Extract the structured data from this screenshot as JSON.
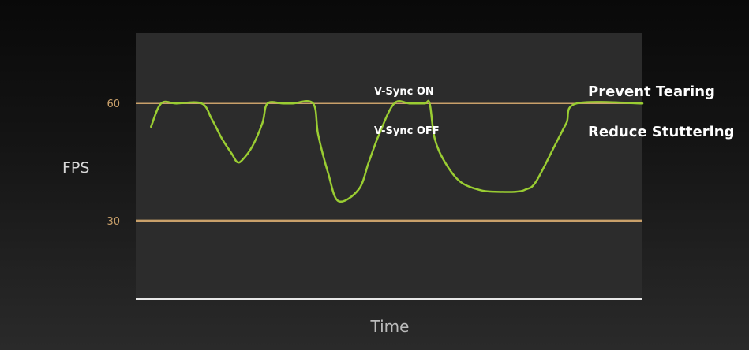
{
  "chart_data": {
    "type": "line",
    "xlabel": "Time",
    "ylabel": "FPS",
    "ylim": [
      10,
      78
    ],
    "xlim": [
      0,
      100
    ],
    "ticks": [
      {
        "value": 60,
        "label": "60"
      },
      {
        "value": 30,
        "label": "30"
      }
    ],
    "series": [
      {
        "color": "#9acd32",
        "x": [
          3,
          5,
          8,
          13,
          15,
          17,
          19,
          20,
          21,
          23,
          25,
          26,
          29,
          31,
          35,
          36,
          38,
          40,
          44,
          46,
          48,
          51,
          54,
          57,
          58,
          59,
          61,
          64,
          68,
          71,
          75,
          77,
          79,
          83,
          85,
          87,
          100
        ],
        "y": [
          54,
          60,
          60,
          60,
          56,
          51,
          47,
          45,
          45.5,
          49,
          55,
          60,
          60,
          60,
          60,
          52,
          42,
          35,
          38,
          45,
          52,
          60,
          60,
          60,
          60,
          51,
          45,
          40,
          37.8,
          37.4,
          37.4,
          38,
          40,
          50,
          55,
          60,
          60
        ]
      }
    ],
    "annotations": [
      {
        "text": "V-Sync ON"
      },
      {
        "text": "V-Sync OFF"
      }
    ],
    "side_labels": [
      "Prevent Tearing",
      "Reduce Stuttering"
    ],
    "colors": {
      "plot_background": "#2c2c2c",
      "reference_line": "#c9a06a",
      "axis_line": "#e8e8e8",
      "series": "#9acd32"
    }
  }
}
